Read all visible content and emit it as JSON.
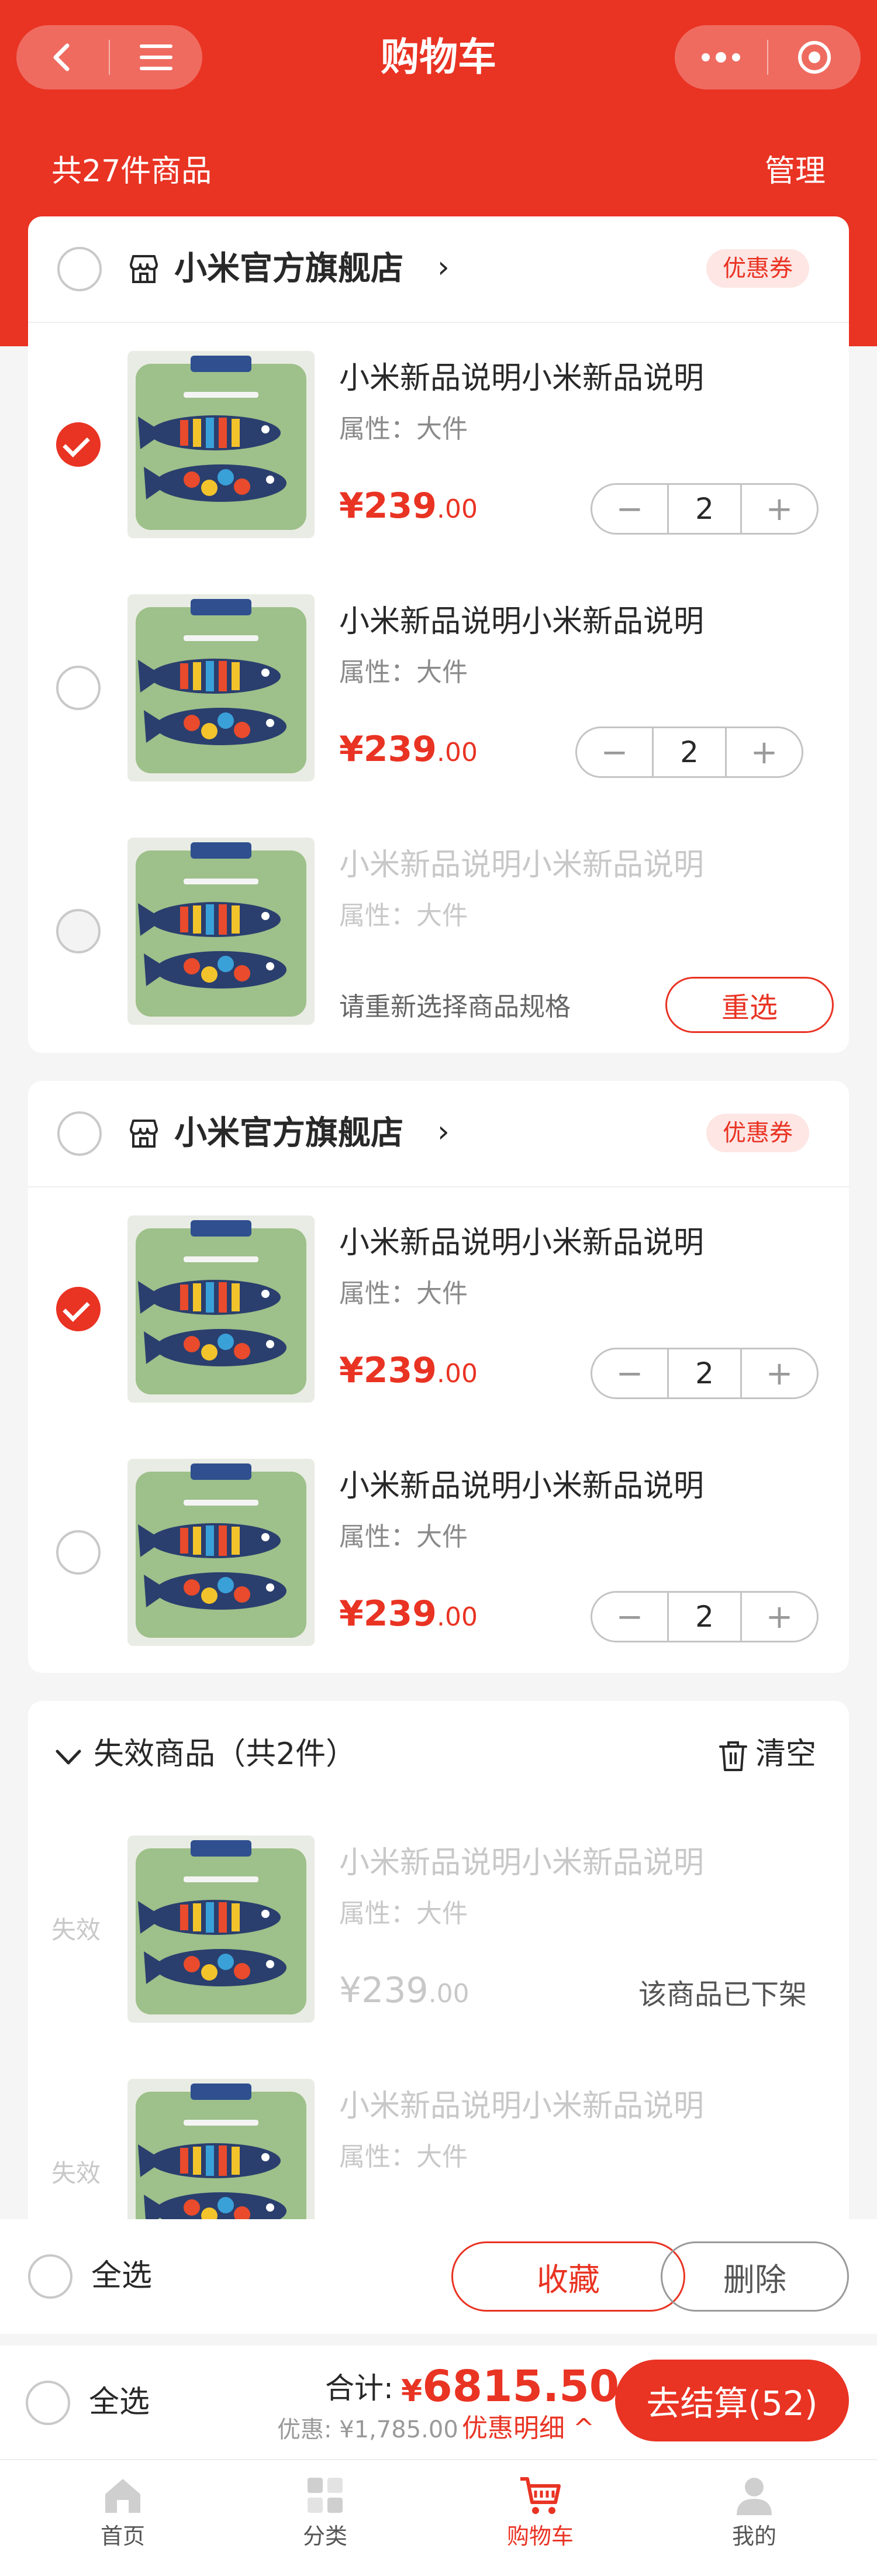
{
  "nav": {
    "title": "购物车"
  },
  "summary": {
    "count_text": "共27件商品",
    "manage": "管理"
  },
  "colors": {
    "accent": "#e93323",
    "background": "#f5f5f5"
  },
  "store1": {
    "name": "小米官方旗舰店",
    "coupon": "优惠券",
    "items": [
      {
        "title": "小米新品说明小米新品说明",
        "attr": "属性：大件",
        "price_int": "¥239",
        "price_dec": ".00",
        "qty": "2",
        "checked": true
      },
      {
        "title": "小米新品说明小米新品说明",
        "attr": "属性：大件",
        "price_int": "¥239",
        "price_dec": ".00",
        "qty": "2",
        "checked": false
      },
      {
        "title": "小米新品说明小米新品说明",
        "attr": "属性：大件",
        "tip": "请重新选择商品规格",
        "reselect": "重选",
        "checked": false
      }
    ]
  },
  "store2": {
    "name": "小米官方旗舰店",
    "coupon": "优惠券",
    "items": [
      {
        "title": "小米新品说明小米新品说明",
        "attr": "属性：大件",
        "price_int": "¥239",
        "price_dec": ".00",
        "qty": "2",
        "checked": true
      },
      {
        "title": "小米新品说明小米新品说明",
        "attr": "属性：大件",
        "price_int": "¥239",
        "price_dec": ".00",
        "qty": "2",
        "checked": false
      }
    ]
  },
  "invalid": {
    "header": "失效商品（共2件）",
    "clear": "清空",
    "tag": "失效",
    "items": [
      {
        "title": "小米新品说明小米新品说明",
        "attr": "属性：大件",
        "price_int": "¥239",
        "price_dec": ".00",
        "status": "该商品已下架"
      },
      {
        "title": "小米新品说明小米新品说明",
        "attr": "属性：大件"
      }
    ]
  },
  "edit_bar": {
    "select_all": "全选",
    "favorite": "收藏",
    "delete": "删除"
  },
  "settle_bar": {
    "select_all": "全选",
    "total_label": "合计:",
    "total_currency": "¥",
    "total_value": "6815.50",
    "discount": "优惠: ¥1,785.00",
    "detail": "优惠明细 ^",
    "checkout": "去结算(52)"
  },
  "tabbar": [
    {
      "label": "首页",
      "icon": "home-icon"
    },
    {
      "label": "分类",
      "icon": "category-icon"
    },
    {
      "label": "购物车",
      "icon": "cart-icon",
      "active": true
    },
    {
      "label": "我的",
      "icon": "user-icon"
    }
  ]
}
